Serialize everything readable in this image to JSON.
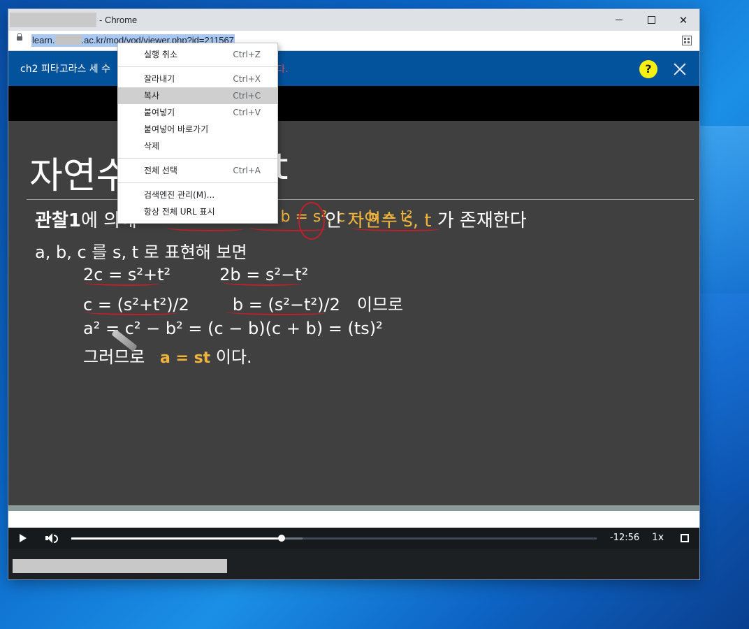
{
  "window": {
    "title_suffix": "- Chrome",
    "controls": {
      "minimize": "minimize",
      "maximize": "maximize",
      "close": "✕"
    }
  },
  "address": {
    "url_prefix": "learn.",
    "url_suffix": ".ac.kr/mod/vod/viewer.php?id=211567"
  },
  "player": {
    "lesson_title": "ch2 피타고라스 세 수",
    "lesson_title_tail": "다.",
    "help_label": "?",
    "time_remaining": "-12:56",
    "speed": "1x",
    "progress_fraction": 0.4,
    "buffer_fraction": 0.44
  },
  "slide": {
    "title": "자연수",
    "title_tail": "t",
    "line1_prefix": "관찰1",
    "line1_mid": "에 의해",
    "line1_eq": "c + b = s², c − b = t²",
    "line1_in": "인",
    "line1_highlight": "자연수 s, t",
    "line1_end": "가 존재한다",
    "line2": "a, b, c 를  s, t 로 표현해 보면",
    "eq1_left": "2c = s²+t²",
    "eq1_right": "2b = s²−t²",
    "eq2_left": "c = (s²+t²)/2",
    "eq2_right": "b = (s²−t²)/2",
    "eq2_tail": "이므로",
    "eq3": "a² = c² − b² = (c − b)(c + b) = (ts)²",
    "eq4_prefix": "그러므로",
    "eq4_highlight": "a = st",
    "eq4_suffix": "이다."
  },
  "context_menu": {
    "items": [
      {
        "label": "실행 취소",
        "shortcut": "Ctrl+Z"
      },
      {
        "label": "잘라내기",
        "shortcut": "Ctrl+X"
      },
      {
        "label": "복사",
        "shortcut": "Ctrl+C"
      },
      {
        "label": "붙여넣기",
        "shortcut": "Ctrl+V"
      },
      {
        "label": "붙여넣어 바로가기",
        "shortcut": ""
      },
      {
        "label": "삭제",
        "shortcut": ""
      },
      {
        "label": "전체 선택",
        "shortcut": "Ctrl+A"
      },
      {
        "label": "검색엔진 관리(M)...",
        "shortcut": ""
      },
      {
        "label": "항상 전체 URL 표시",
        "shortcut": ""
      }
    ]
  }
}
